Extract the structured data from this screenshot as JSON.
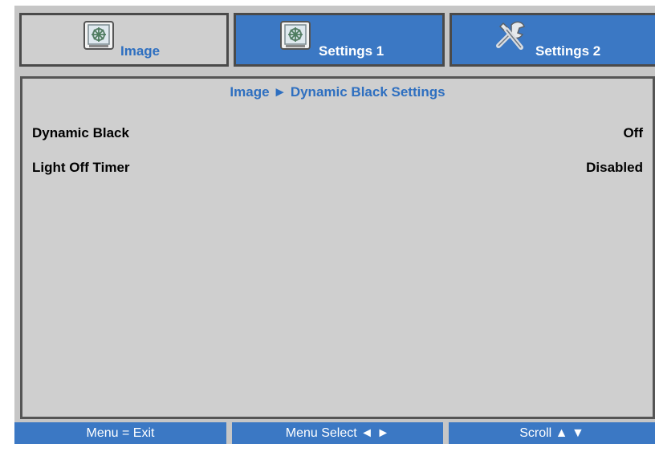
{
  "tabs": [
    {
      "label": "Image",
      "icon": "image-icon",
      "state": "inactive"
    },
    {
      "label": "Settings 1",
      "icon": "image-icon",
      "state": "active"
    },
    {
      "label": "Settings 2",
      "icon": "tools-icon",
      "state": "active"
    }
  ],
  "breadcrumb": "Image ► Dynamic Black Settings",
  "settings": [
    {
      "label": "Dynamic Black",
      "value": "Off"
    },
    {
      "label": "Light Off Timer",
      "value": "Disabled"
    }
  ],
  "footer": [
    "Menu = Exit",
    "Menu Select ◄ ►",
    "Scroll ▲ ▼"
  ],
  "colors": {
    "accent_blue": "#3b78c4",
    "tab_text_blue": "#2e6fc0",
    "panel_gray": "#cfcfcf",
    "frame_gray": "#c6c6c6"
  }
}
